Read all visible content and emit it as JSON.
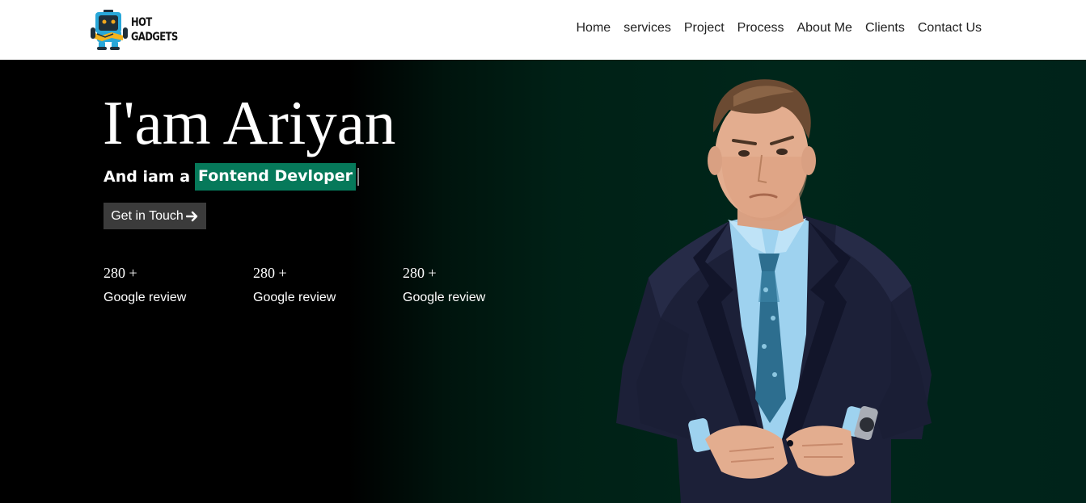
{
  "header": {
    "logo": {
      "line1": "HOT",
      "line2": "GADGETS",
      "icon": "robot-mascot-icon",
      "colors": {
        "body": "#28a7d9",
        "face": "#1f2f3a",
        "accent": "#f5b41c",
        "eyes": "#f2a81d"
      }
    },
    "nav": [
      {
        "label": "Home"
      },
      {
        "label": "services"
      },
      {
        "label": "Project"
      },
      {
        "label": "Process"
      },
      {
        "label": "About Me"
      },
      {
        "label": "Clients"
      },
      {
        "label": "Contact Us"
      }
    ]
  },
  "hero": {
    "title": "I'am Ariyan",
    "subtitle_prefix": "And iam a",
    "typed_role": "Fontend Devloper",
    "cta": {
      "label": "Get in Touch",
      "icon": "arrow-right-icon"
    },
    "stats": [
      {
        "value": "280 +",
        "label": "Google review"
      },
      {
        "value": "280 +",
        "label": "Google review"
      },
      {
        "value": "280 +",
        "label": "Google review"
      }
    ],
    "portrait": "man-in-navy-suit-photo"
  },
  "colors": {
    "header_bg": "#ffffff",
    "hero_bg_left": "#000000",
    "hero_bg_right": "#00261a",
    "highlight": "#06795a",
    "button_bg": "#3b3b3b"
  }
}
